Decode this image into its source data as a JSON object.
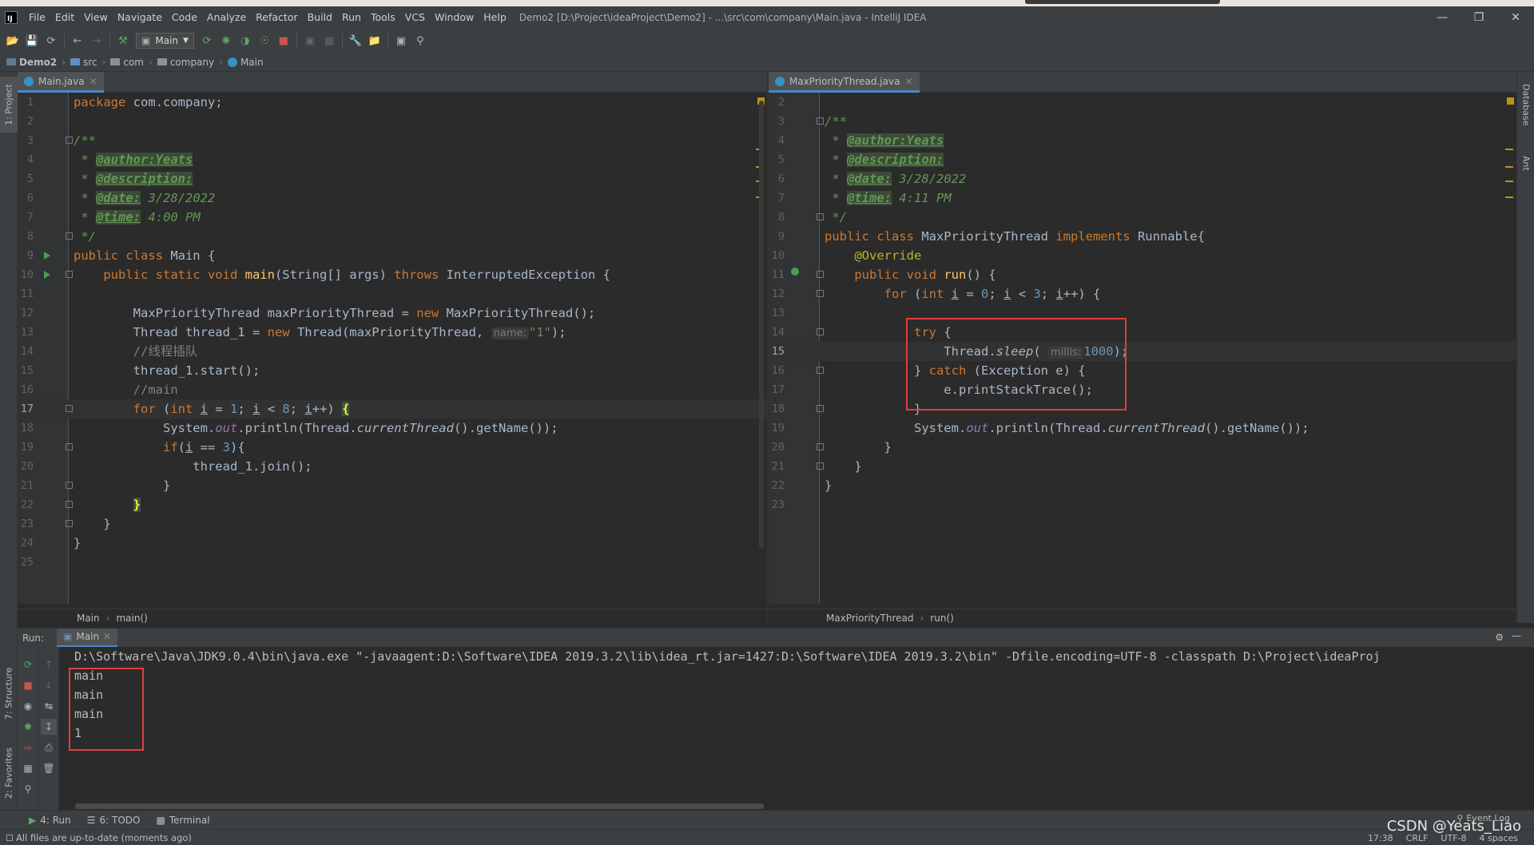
{
  "window": {
    "title": "Demo2 [D:\\Project\\ideaProject\\Demo2] - ...\\src\\com\\company\\Main.java - IntelliJ IDEA",
    "menu": [
      "File",
      "Edit",
      "View",
      "Navigate",
      "Code",
      "Analyze",
      "Refactor",
      "Build",
      "Run",
      "Tools",
      "VCS",
      "Window",
      "Help"
    ],
    "controls": [
      "—",
      "❐",
      "✕"
    ]
  },
  "toolbar": {
    "run_config": "Main"
  },
  "breadcrumb": [
    "Demo2",
    "src",
    "com",
    "company",
    "Main"
  ],
  "side_tabs": {
    "left": [
      "1: Project",
      "7: Structure",
      "2: Favorites"
    ],
    "right": [
      "Database",
      "Ant"
    ]
  },
  "editor_left": {
    "tab": "Main.java",
    "close": "✕",
    "numbers": [
      "1",
      "2",
      "3",
      "4",
      "5",
      "6",
      "7",
      "8",
      "9",
      "10",
      "11",
      "12",
      "13",
      "14",
      "15",
      "16",
      "17",
      "18",
      "19",
      "20",
      "21",
      "22",
      "23",
      "24",
      "25"
    ],
    "lines": {
      "l1_kw": "package",
      "l1_rest": " com.company;",
      "l3": "/**",
      "l4_pre": " * ",
      "l4_tag": "@author:Yeats",
      "l5_pre": " * ",
      "l5_tag": "@description:",
      "l6_pre": " * ",
      "l6_tag": "@date:",
      "l6_rest": " 3/28/2022",
      "l7_pre": " * ",
      "l7_tag": "@time:",
      "l7_rest": " 4:00 PM",
      "l8": " */",
      "l9_kw": "public class",
      "l9_rest": " Main {",
      "l10_kw1": "    public static void ",
      "l10_fn": "main",
      "l10_mid": "(String[] args) ",
      "l10_kw2": "throws",
      "l10_rest": " InterruptedException {",
      "l12_a": "        MaxPriorityThread maxPriorityThread = ",
      "l12_kw": "new",
      "l12_b": " MaxPriorityThread();",
      "l13_a": "        Thread thread_1 = ",
      "l13_kw": "new",
      "l13_b": " Thread(maxPriorityThread, ",
      "l13_hint": "name:",
      "l13_str": "\"1\"",
      "l13_c": ");",
      "l14": "        //线程插队",
      "l15": "        thread_1.start();",
      "l16": "        //main",
      "l17_ind": "        ",
      "l17_kw1": "for",
      "l17_a": " (",
      "l17_kw2": "int",
      "l17_sp": " ",
      "l17_i1": "i",
      "l17_b": " = ",
      "l17_n1": "1",
      "l17_c": "; ",
      "l17_i2": "i",
      "l17_d": " < ",
      "l17_n2": "8",
      "l17_e": "; ",
      "l17_i3": "i",
      "l17_f": "++) ",
      "l17_br": "{",
      "l18_a": "            System.",
      "l18_out": "out",
      "l18_b": ".println(Thread.",
      "l18_ct": "currentThread",
      "l18_c": "().getName());",
      "l19_ind": "            ",
      "l19_kw": "if",
      "l19_a": "(",
      "l19_i": "i",
      "l19_b": " == ",
      "l19_n": "3",
      "l19_c": "){",
      "l20": "                thread_1.join();",
      "l21": "            }",
      "l22_ind": "        ",
      "l22_br": "}",
      "l23": "    }",
      "l24": "}"
    },
    "crumb": [
      "Main",
      "main()"
    ]
  },
  "editor_right": {
    "tab": "MaxPriorityThread.java",
    "close": "✕",
    "numbers": [
      "2",
      "3",
      "4",
      "5",
      "6",
      "7",
      "8",
      "9",
      "10",
      "11",
      "12",
      "13",
      "14",
      "15",
      "16",
      "17",
      "18",
      "19",
      "20",
      "21",
      "22",
      "23"
    ],
    "lines": {
      "r3": "/**",
      "r4_pre": " * ",
      "r4_tag": "@author:Yeats",
      "r5_pre": " * ",
      "r5_tag": "@description:",
      "r6_pre": " * ",
      "r6_tag": "@date:",
      "r6_rest": " 3/28/2022",
      "r7_pre": " * ",
      "r7_tag": "@time:",
      "r7_rest": " 4:11 PM",
      "r8": " */",
      "r9_kw1": "public class",
      "r9_a": " MaxPriorityThread ",
      "r9_kw2": "implements",
      "r9_b": " Runnable{",
      "r10": "    @Override",
      "r11_kw": "    public void ",
      "r11_fn": "run",
      "r11_rest": "() {",
      "r12_ind": "        ",
      "r12_kw1": "for",
      "r12_a": " (",
      "r12_kw2": "int",
      "r12_sp": " ",
      "r12_i1": "i",
      "r12_b": " = ",
      "r12_n1": "0",
      "r12_c": "; ",
      "r12_i2": "i",
      "r12_d": " < ",
      "r12_n2": "3",
      "r12_e": "; ",
      "r12_i3": "i",
      "r12_f": "++) {",
      "r14_ind": "            ",
      "r14_kw": "try",
      "r14_rest": " {",
      "r15_a": "                Thread.",
      "r15_fn": "sleep",
      "r15_b": "( ",
      "r15_hint": "millis:",
      "r15_num": "1000",
      "r15_c": ");",
      "r16_a": "            } ",
      "r16_kw": "catch",
      "r16_b": " (Exception e) {",
      "r17": "                e.printStackTrace();",
      "r18": "            }",
      "r19_a": "            System.",
      "r19_out": "out",
      "r19_b": ".println(Thread.",
      "r19_ct": "currentThread",
      "r19_c": "().getName());",
      "r20": "        }",
      "r21": "    }",
      "r22": "}"
    },
    "crumb": [
      "MaxPriorityThread",
      "run()"
    ]
  },
  "run_panel": {
    "label": "Run:",
    "tab": "Main",
    "close": "✕",
    "command": "D:\\Software\\Java\\JDK9.0.4\\bin\\java.exe \"-javaagent:D:\\Software\\IDEA 2019.3.2\\lib\\idea_rt.jar=1427:D:\\Software\\IDEA 2019.3.2\\bin\" -Dfile.encoding=UTF-8 -classpath D:\\Project\\ideaProj",
    "output": [
      "main",
      "main",
      "main",
      "1"
    ]
  },
  "bottom_tabs": [
    "4: Run",
    "6: TODO",
    "Terminal"
  ],
  "event_log": "Event Log",
  "status": {
    "message": "All files are up-to-date (moments ago)",
    "position": "17:38",
    "line_sep": "CRLF",
    "encoding": "UTF-8",
    "indent": "4 spaces"
  },
  "watermark": "CSDN @Yeats_Liao",
  "colors": {
    "background": "#2b2b2b",
    "chrome": "#3c3f41",
    "keyword": "#cc7832",
    "doc_comment": "#629755",
    "string": "#6a8759",
    "number": "#6897bb",
    "function": "#ffc66d",
    "highlight_box": "#e03e3e"
  }
}
